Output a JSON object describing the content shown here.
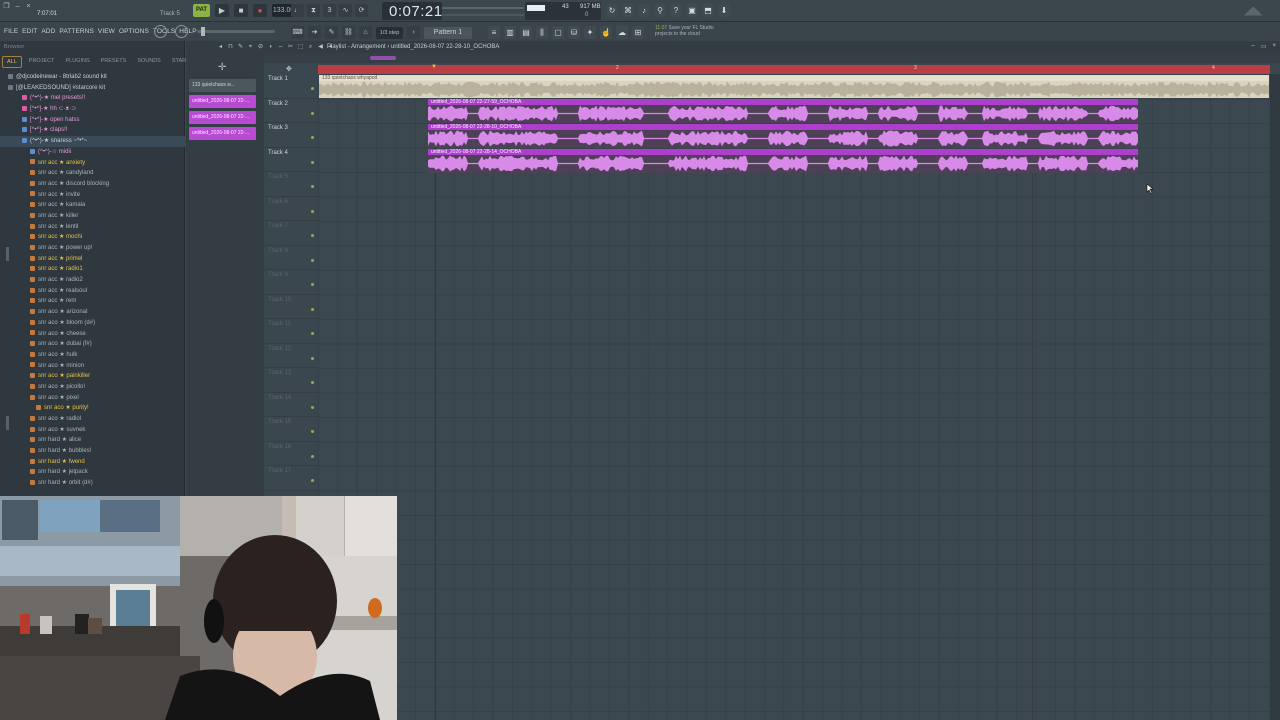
{
  "app": {
    "song_position": "7:07:01",
    "hint_text": "Track 5",
    "pattern_toggle": "PAT",
    "tempo": "133.000",
    "time_display": "0:07:21",
    "cpu": "43",
    "mem": "917 MB",
    "poly": "0",
    "news_time": "11:07",
    "news_text": "Save your FL Studio projects to the cloud"
  },
  "menu": [
    "FILE",
    "EDIT",
    "ADD",
    "PATTERNS",
    "VIEW",
    "OPTIONS",
    "TOOLS",
    "HELP"
  ],
  "toolbar": {
    "snap": "1/3 step",
    "pattern": "Pattern 1"
  },
  "browser": {
    "title": "Browser",
    "tabs": [
      "ALL",
      "PROJECT",
      "PLUGINS",
      "PRESETS",
      "SOUNDS",
      "STARRED"
    ],
    "items": [
      {
        "label": "@djcodeinewar - 8trlab2 sound kit",
        "style": "wh",
        "indent": 8,
        "icon": "folder"
      },
      {
        "label": "[@LEAKEDSOUND] #starcore kit",
        "style": "wh",
        "indent": 8,
        "icon": "folder"
      },
      {
        "label": "(^•^)-★ mel presets!!",
        "style": "pk",
        "indent": 22,
        "icon": "pink"
      },
      {
        "label": "[^•^]-★ hh ⊂·ᴥ·⊃",
        "style": "pk",
        "indent": 22,
        "icon": "pink"
      },
      {
        "label": "[^•^]-★ open hatss",
        "style": "pk",
        "indent": 22,
        "icon": "blue"
      },
      {
        "label": "[^•^]-★ claps!!",
        "style": "pk",
        "indent": 22,
        "icon": "blue"
      },
      {
        "label": "(^•^)-★ snaress ~*•*~",
        "style": "wh",
        "indent": 22,
        "icon": "blue",
        "highlight": true
      },
      {
        "label": "(^•^)-☆ midii",
        "style": "pk",
        "indent": 30,
        "icon": "blue"
      },
      {
        "label": "snr acc ★ anxiety",
        "style": "yl",
        "indent": 30,
        "icon": "orange"
      },
      {
        "label": "snr acc ★ candyland",
        "style": "n",
        "indent": 30,
        "icon": "orange"
      },
      {
        "label": "snr acc ★ discord blocking",
        "style": "n",
        "indent": 30,
        "icon": "orange"
      },
      {
        "label": "snr acc ★ invite",
        "style": "n",
        "indent": 30,
        "icon": "orange"
      },
      {
        "label": "snr acc ★ kamala",
        "style": "n",
        "indent": 30,
        "icon": "orange"
      },
      {
        "label": "snr acc ★ killer",
        "style": "n",
        "indent": 30,
        "icon": "orange"
      },
      {
        "label": "snr acc ★ lentil",
        "style": "n",
        "indent": 30,
        "icon": "orange"
      },
      {
        "label": "snr acc ★ mochi",
        "style": "yl",
        "indent": 30,
        "icon": "orange"
      },
      {
        "label": "snr acc ★ power up!",
        "style": "n",
        "indent": 30,
        "icon": "orange"
      },
      {
        "label": "snr acc ★ primel",
        "style": "yl",
        "indent": 30,
        "icon": "orange"
      },
      {
        "label": "snr acc ★ radio1",
        "style": "yl",
        "indent": 30,
        "icon": "orange"
      },
      {
        "label": "snr acc ★ radio2",
        "style": "n",
        "indent": 30,
        "icon": "orange"
      },
      {
        "label": "snr acc ★ realsoul",
        "style": "n",
        "indent": 30,
        "icon": "orange"
      },
      {
        "label": "snr acc ★ rem",
        "style": "n",
        "indent": 30,
        "icon": "orange"
      },
      {
        "label": "snr aco ★ arizonal",
        "style": "n",
        "indent": 30,
        "icon": "orange"
      },
      {
        "label": "snr aco ★ bloom (d#)",
        "style": "n",
        "indent": 30,
        "icon": "orange"
      },
      {
        "label": "snr aco ★ cheese",
        "style": "n",
        "indent": 30,
        "icon": "orange"
      },
      {
        "label": "snr aco ★ dubai (f#)",
        "style": "n",
        "indent": 30,
        "icon": "orange"
      },
      {
        "label": "snr aco ★ hulk",
        "style": "n",
        "indent": 30,
        "icon": "orange"
      },
      {
        "label": "snr aco ★ minion",
        "style": "n",
        "indent": 30,
        "icon": "orange"
      },
      {
        "label": "snr aco ★ painkiller",
        "style": "yl",
        "indent": 30,
        "icon": "orange"
      },
      {
        "label": "snr aco ★ picollo!",
        "style": "n",
        "indent": 30,
        "icon": "orange"
      },
      {
        "label": "snr aco ★ pixel",
        "style": "n",
        "indent": 30,
        "icon": "orange"
      },
      {
        "label": "snr aco ★ purity!",
        "style": "yl",
        "indent": 36,
        "icon": "orange"
      },
      {
        "label": "snr aco ★ radiol",
        "style": "n",
        "indent": 30,
        "icon": "orange"
      },
      {
        "label": "snr aco ★ suvnek",
        "style": "n",
        "indent": 30,
        "icon": "orange"
      },
      {
        "label": "snr hard ★ alice",
        "style": "n",
        "indent": 30,
        "icon": "orange"
      },
      {
        "label": "snr hard ★ bubbles!",
        "style": "n",
        "indent": 30,
        "icon": "orange"
      },
      {
        "label": "snr hard ★ fwend",
        "style": "yl",
        "indent": 30,
        "icon": "orange"
      },
      {
        "label": "snr hard ★ jetpack",
        "style": "n",
        "indent": 30,
        "icon": "orange"
      },
      {
        "label": "snr hard ★ orbit (d#)",
        "style": "n",
        "indent": 30,
        "icon": "orange"
      }
    ]
  },
  "channels": [
    {
      "label": "133 quietchaos w...",
      "kind": "audio"
    },
    {
      "label": "untitled_2026-08-07 22-...",
      "kind": "clip"
    },
    {
      "label": "untitled_2026-08-07 22-...",
      "kind": "clip"
    },
    {
      "label": "untitled_2026-08-07 22-...",
      "kind": "clip"
    }
  ],
  "playlist": {
    "title": "Playlist - Arrangement › untitled_2026-08-07 22-28-10_OCHOBA",
    "tracks": [
      "Track 1",
      "Track 2",
      "Track 3",
      "Track 4",
      "Track 5",
      "Track 6",
      "Track 7",
      "Track 8",
      "Track 9",
      "Track 10",
      "Track 11",
      "Track 12",
      "Track 13",
      "Track 14",
      "Track 15",
      "Track 16",
      "Track 17"
    ],
    "timeline_numbers": [
      "2",
      "3",
      "4"
    ],
    "clips": [
      {
        "name": "133 quietchaos whyapod",
        "kind": "audio"
      },
      {
        "name": "untitled_2026-08-07 22-27-59_OCHOBA",
        "kind": "pink"
      },
      {
        "name": "untitled_2026-08-07 22-28-10_OCHOBA",
        "kind": "pink"
      },
      {
        "name": "untitled_2026-08-07 22-28-14_OCHOBA",
        "kind": "pink"
      }
    ]
  },
  "colors": {
    "accent": "#8bb346",
    "clip": "#ad3fcc",
    "timeline": "#ba3f45"
  }
}
